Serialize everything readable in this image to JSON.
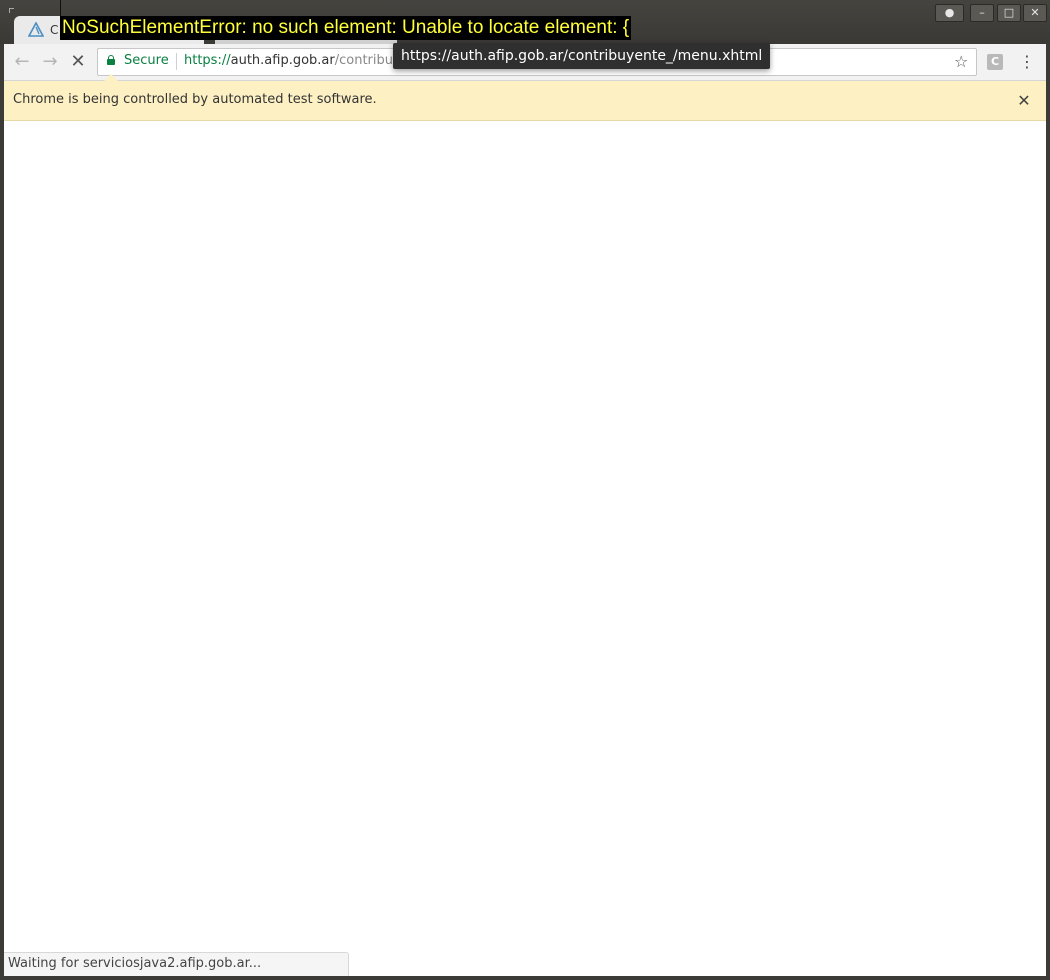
{
  "tabs": [
    {
      "label": "C",
      "favicon": "afip-logo-icon",
      "active": true
    },
    {
      "label": "",
      "active": false
    }
  ],
  "window_controls": {
    "user": "●",
    "minimize": "–",
    "maximize": "□",
    "close": "✕"
  },
  "error_overlay": "NoSuchElementError: no such element: Unable to locate element: {",
  "toolbar": {
    "back": "←",
    "forward": "→",
    "stop": "✕",
    "secure_label": "Secure",
    "url_scheme": "https",
    "url_sep": "://",
    "url_host": "auth.afip.gob.ar",
    "url_path": "/contribuy",
    "star": "☆",
    "extension": "C",
    "menu": "⋮"
  },
  "url_tooltip": "https://auth.afip.gob.ar/contribuyente_/menu.xhtml",
  "infobar": {
    "message": "Chrome is being controlled by automated test software.",
    "close": "✕"
  },
  "status_bar": "Waiting for serviciosjava2.afip.gob.ar...",
  "colors": {
    "secure_green": "#0b8043",
    "infobar_bg": "#fdf1c4",
    "error_text": "#ffff3a",
    "error_bg": "#000000"
  }
}
